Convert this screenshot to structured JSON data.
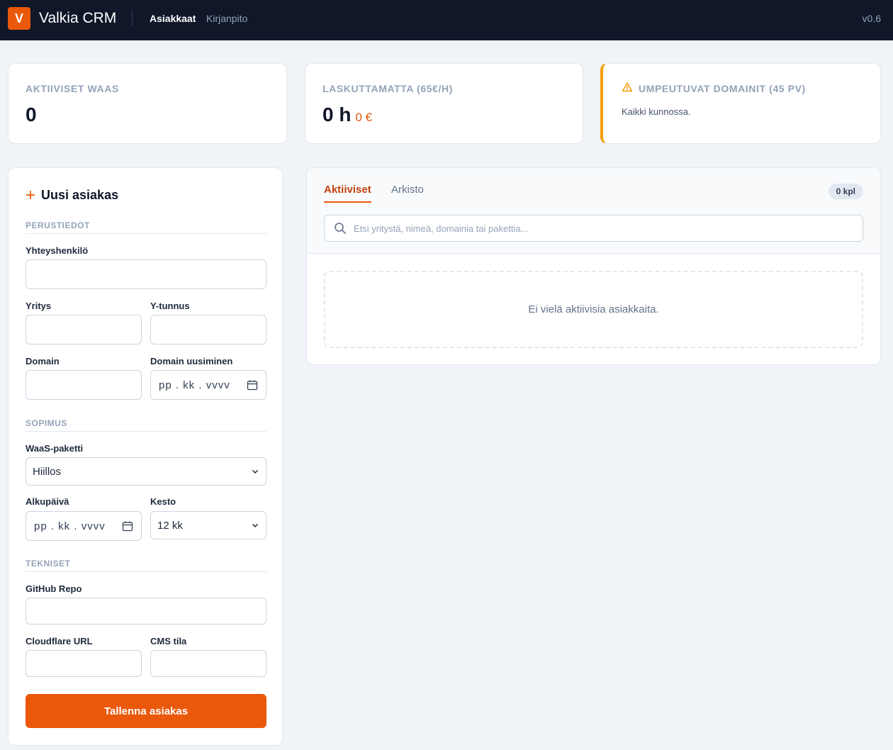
{
  "header": {
    "logo_letter": "V",
    "app_title": "Valkia CRM",
    "nav": [
      {
        "label": "Asiakkaat",
        "active": true
      },
      {
        "label": "Kirjanpito",
        "active": false
      }
    ],
    "version": "v0.6"
  },
  "stats": {
    "active_waas": {
      "label": "AKTIIVISET WAAS",
      "value": "0"
    },
    "unbilled": {
      "label": "LASKUTTAMATTA (65€/H)",
      "value": "0 h",
      "amount": "0 €"
    },
    "expiring": {
      "label": "UMPEUTUVAT DOMAINIT (45 PV)",
      "text": "Kaikki kunnossa.",
      "icon": "warning-icon"
    }
  },
  "form": {
    "title": "Uusi asiakas",
    "sections": {
      "basic": "PERUSTIEDOT",
      "contract": "SOPIMUS",
      "technical": "TEKNISET"
    },
    "fields": {
      "contact": "Yhteyshenkilö",
      "company": "Yritys",
      "business_id": "Y-tunnus",
      "domain": "Domain",
      "domain_renewal": "Domain uusiminen",
      "domain_renewal_placeholder": "pp . kk . vvvv",
      "package": "WaaS-paketti",
      "package_value": "Hiillos",
      "start_date": "Alkupäivä",
      "start_date_placeholder": "pp . kk . vvvv",
      "duration": "Kesto",
      "duration_value": "12 kk",
      "github": "GitHub Repo",
      "cloudflare": "Cloudflare URL",
      "cms": "CMS tila"
    },
    "save_label": "Tallenna asiakas"
  },
  "list": {
    "tabs": [
      "Aktiiviset",
      "Arkisto"
    ],
    "count": "0 kpl",
    "search_placeholder": "Etsi yritystä, nimeä, domainia tai pakettia...",
    "empty_text": "Ei vielä aktiivisia asiakkaita."
  },
  "colors": {
    "accent": "#ea580c",
    "navbar": "#0f1729",
    "warning": "#f59e0b"
  }
}
